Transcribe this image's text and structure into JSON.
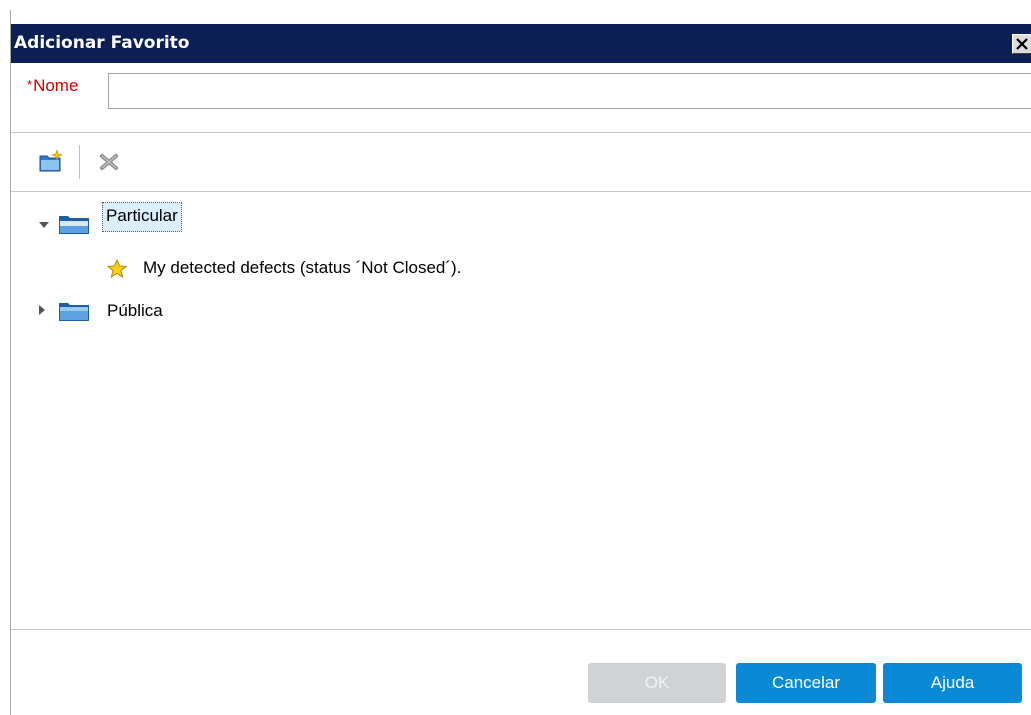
{
  "window": {
    "title": "Adicionar Favorito",
    "close_icon": "close-icon"
  },
  "form": {
    "required_marker": "*",
    "name_label": "Nome",
    "name_value": "",
    "name_placeholder": ""
  },
  "toolbar": {
    "new_folder_icon": "new-folder-icon",
    "delete_icon": "delete-icon"
  },
  "tree": {
    "nodes": [
      {
        "label": "Particular",
        "expanded": true,
        "selected": true,
        "icon": "folder-icon"
      },
      {
        "label": "My detected defects (status ´Not Closed´).",
        "icon": "star-icon",
        "level": 2
      },
      {
        "label": "Pública",
        "expanded": false,
        "selected": false,
        "icon": "folder-icon"
      }
    ]
  },
  "buttons": {
    "ok": "OK",
    "cancel": "Cancelar",
    "help": "Ajuda"
  },
  "colors": {
    "titlebar": "#0b1f55",
    "primary_button": "#0a8ad6",
    "disabled_button": "#cfd3d6",
    "required": "#d40000",
    "selection": "#dbeefb"
  }
}
